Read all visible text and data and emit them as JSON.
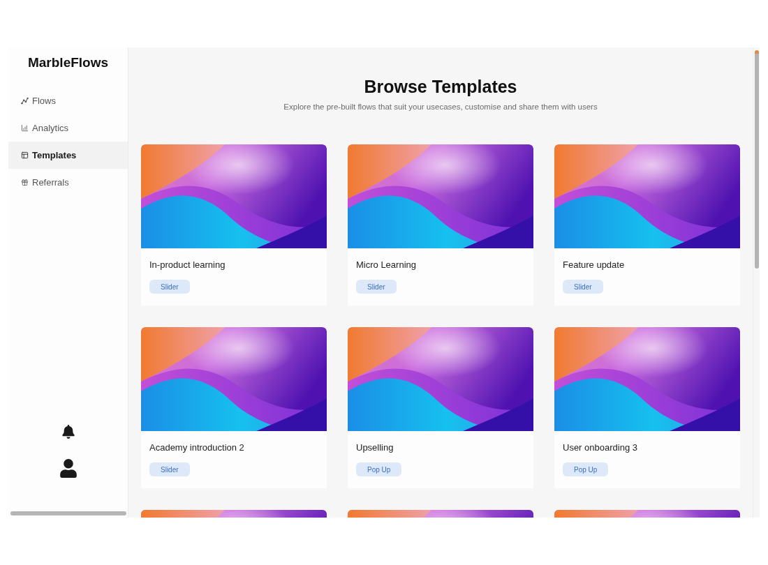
{
  "sidebar": {
    "logo": "MarbleFlows",
    "nav_items": [
      {
        "label": "Flows",
        "selected": false
      },
      {
        "label": "Analytics",
        "selected": false
      },
      {
        "label": "Templates",
        "selected": true
      },
      {
        "label": "Referrals",
        "selected": false
      }
    ]
  },
  "header": {
    "title": "Browse Templates",
    "subtitle": "Explore the pre-built flows that suit your usecases, customise and share them with users"
  },
  "templates": [
    {
      "kind": "card",
      "title": "In-product learning",
      "tag": "Slider"
    },
    {
      "kind": "card",
      "title": "Micro Learning",
      "tag": "Slider"
    },
    {
      "kind": "card",
      "title": "Feature update",
      "tag": "Slider"
    },
    {
      "kind": "card",
      "title": "Academy introduction 2",
      "tag": "Slider"
    },
    {
      "kind": "card",
      "title": "Upselling",
      "tag": "Pop Up"
    },
    {
      "kind": "card",
      "title": "User onboarding 3",
      "tag": "Pop Up"
    },
    {
      "kind": "cut_off"
    },
    {
      "kind": "cut_off"
    },
    {
      "kind": "cut_off"
    }
  ]
}
